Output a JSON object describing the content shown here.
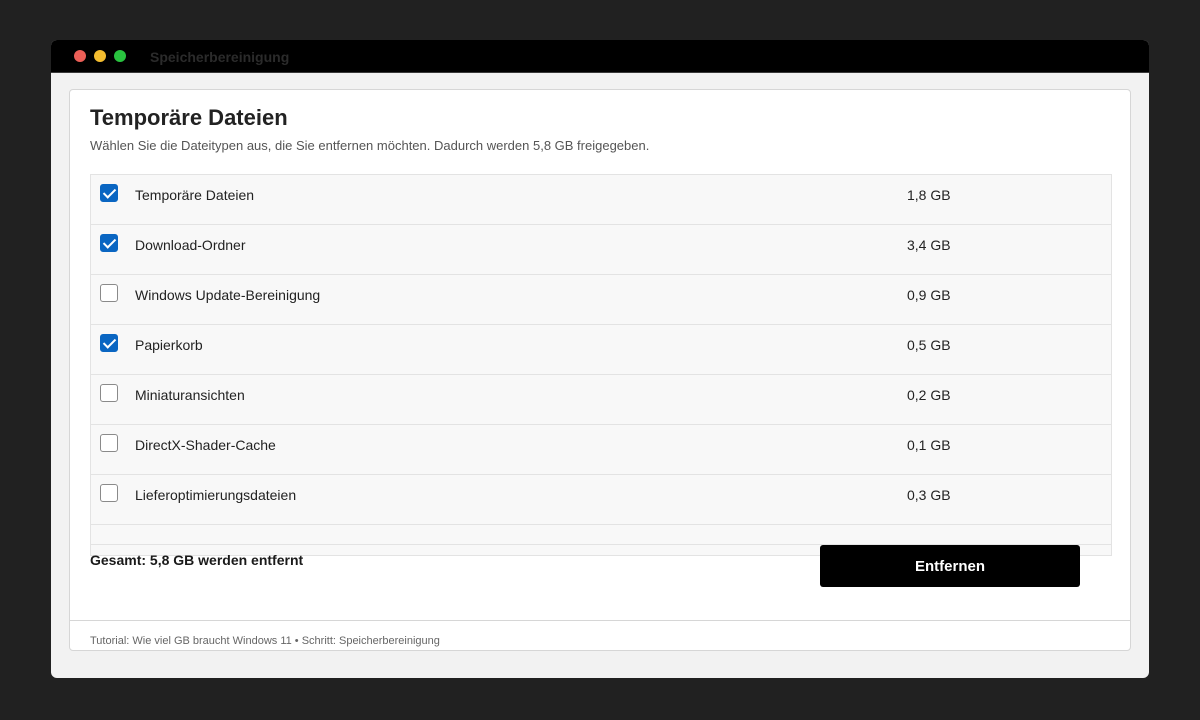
{
  "window": {
    "title": "Speicherbereinigung"
  },
  "panel": {
    "heading": "Temporäre Dateien",
    "subtitle": "Wählen Sie die Dateitypen aus, die Sie entfernen möchten. Dadurch werden 5,8 GB freigegeben."
  },
  "items": [
    {
      "label": "Temporäre Dateien",
      "size": "1,8 GB",
      "checked": true
    },
    {
      "label": "Download-Ordner",
      "size": "3,4 GB",
      "checked": true
    },
    {
      "label": "Windows Update-Bereinigung",
      "size": "0,9 GB",
      "checked": false
    },
    {
      "label": "Papierkorb",
      "size": "0,5 GB",
      "checked": true
    },
    {
      "label": "Miniaturansichten",
      "size": "0,2 GB",
      "checked": false
    },
    {
      "label": "DirectX-Shader-Cache",
      "size": "0,1 GB",
      "checked": false
    },
    {
      "label": "Lieferoptimierungsdateien",
      "size": "0,3 GB",
      "checked": false
    }
  ],
  "summary": {
    "total": "Gesamt: 5,8 GB werden entfernt",
    "remove_label": "Entfernen"
  },
  "footer": {
    "text": "Tutorial: Wie viel GB braucht Windows 11 • Schritt: Speicherbereinigung"
  },
  "colors": {
    "accent": "#0a66c2",
    "button": "#000000"
  }
}
